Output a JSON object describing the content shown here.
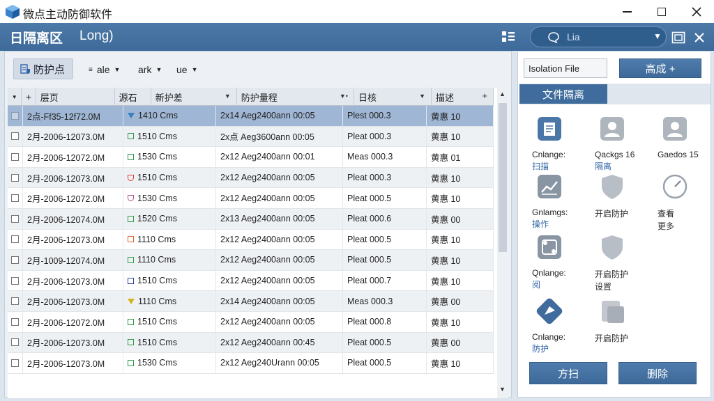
{
  "window": {
    "title": "微点主动防御软件",
    "minimize_icon": "minimize-icon",
    "maximize_icon": "maximize-icon",
    "close_icon": "close-icon"
  },
  "header": {
    "title": "日隔离区",
    "subtitle": "Long)",
    "search_text": "Lia",
    "brand_color": "#3d6a9a"
  },
  "toolbar": {
    "main_button": "防护点",
    "dropdowns": [
      "ale",
      "ark",
      "ue"
    ]
  },
  "table": {
    "columns": [
      "层页",
      "源石",
      "新护差",
      "防护量程",
      "日核",
      "描述"
    ],
    "rows": [
      {
        "c1": "2点-Ff35-12f72.0M",
        "c2": "1410 Cms",
        "c3": "2x14 Aeg2400ann 00:05",
        "c4": "Plest 000.3",
        "c5": "黄惠 10",
        "marker": "tri",
        "color": "#3a7ec2",
        "selected": true
      },
      {
        "c1": "2月-2006-12073.0M",
        "c2": "1510 Cms",
        "c3": "2x点 Aeg3600ann 00:05",
        "c4": "Pleat 000.3",
        "c5": "黄惠 10",
        "marker": "square",
        "color": "#2e9a4a"
      },
      {
        "c1": "2月-2006-12072.0M",
        "c2": "1530 Cms",
        "c3": "2x12 Aeg2400ann 00:01",
        "c4": "Meas 000.3",
        "c5": "黄惠 01",
        "marker": "square",
        "color": "#2e9a4a"
      },
      {
        "c1": "2月-2006-12073.0M",
        "c2": "1510 Cms",
        "c3": "2x12 Aeg2400ann 00:05",
        "c4": "Pleat 000.3",
        "c5": "黄惠 10",
        "marker": "shield",
        "color": "#d7442e"
      },
      {
        "c1": "2月-2006-12072.0M",
        "c2": "1530 Cms",
        "c3": "2x12 Aeg2400ann 00:05",
        "c4": "Pleat 000.5",
        "c5": "黄惠 10",
        "marker": "shield",
        "color": "#b04e8a"
      },
      {
        "c1": "2月-2006-12074.0M",
        "c2": "1520 Cms",
        "c3": "2x13 Aeg2400ann 00:05",
        "c4": "Pleat 000.6",
        "c5": "黄惠 00",
        "marker": "square",
        "color": "#2e9a4a"
      },
      {
        "c1": "2月-2006-12073.0M",
        "c2": "1110 Cms",
        "c3": "2x12 Aeg2400ann 00:05",
        "c4": "Pleat 000.5",
        "c5": "黄惠 10",
        "marker": "square",
        "color": "#e0612b"
      },
      {
        "c1": "2月-1009-12074.0M",
        "c2": "1110 Cms",
        "c3": "2x12 Aeg2400ann 00:05",
        "c4": "Pleat 000.5",
        "c5": "黄惠 10",
        "marker": "square",
        "color": "#2e9a4a"
      },
      {
        "c1": "2月-2006-12073.0M",
        "c2": "1510 Cms",
        "c3": "2x12 Aeg2400ann 00:05",
        "c4": "Pleat 000.7",
        "c5": "黄惠 10",
        "marker": "square",
        "color": "#3441a6"
      },
      {
        "c1": "2月-2006-12073.0M",
        "c2": "1110 Cms",
        "c3": "2x14 Aeg2400ann 00:05",
        "c4": "Meas 000.3",
        "c5": "黄惠 00",
        "marker": "tri",
        "color": "#d3b21f"
      },
      {
        "c1": "2月-2006-12072.0M",
        "c2": "1510 Cms",
        "c3": "2x12 Aeg2400ann 00:05",
        "c4": "Pleat 000.8",
        "c5": "黄惠 10",
        "marker": "square",
        "color": "#2e9a4a"
      },
      {
        "c1": "2月-2006-12073.0M",
        "c2": "1510 Cms",
        "c3": "2x12 Aeg2400ann 00:45",
        "c4": "Pleat 000.5",
        "c5": "黄惠 00",
        "marker": "square",
        "color": "#2e9a4a"
      },
      {
        "c1": "2月-2006-12073.0M",
        "c2": "1530 Cms",
        "c3": "2x12 Aeg240Urann 00:05",
        "c4": "Pleat 000.5",
        "c5": "黄惠 10",
        "marker": "square",
        "color": "#2e9a4a"
      }
    ]
  },
  "right_panel": {
    "isolation_field": "Isolation File",
    "high_button": "高成 +",
    "section_tab": "文件隔离",
    "tiles": [
      {
        "icon": "document-icon",
        "l1": "Cnlange:",
        "l2": "扫描",
        "blue": true
      },
      {
        "icon": "user-icon",
        "l1": "Qackgs 16",
        "l2": "隔离",
        "blue": true
      },
      {
        "icon": "user-icon",
        "l1": "Gaedos 15",
        "l2": "",
        "blue": false
      },
      {
        "icon": "chart-icon",
        "l1": "Gnlamgs:",
        "l2": "操作",
        "blue": true
      },
      {
        "icon": "shield-icon",
        "l1": "开启防护",
        "l2": "",
        "blue": false
      },
      {
        "icon": "clock-icon",
        "l1": "查看",
        "l2": "更多",
        "blue": false
      },
      {
        "icon": "network-icon",
        "l1": "Qnlange:",
        "l2": "阅",
        "blue": true
      },
      {
        "icon": "shield-icon",
        "l1": "开启防护",
        "l2": "设置",
        "blue": false
      },
      {
        "icon": "defense-icon",
        "l1": "Cnlange:",
        "l2": "防护",
        "blue": true
      },
      {
        "icon": "file-icon",
        "l1": "开启防护",
        "l2": "",
        "blue": false
      }
    ],
    "bottom_left": "方扫",
    "bottom_right": "删除"
  }
}
